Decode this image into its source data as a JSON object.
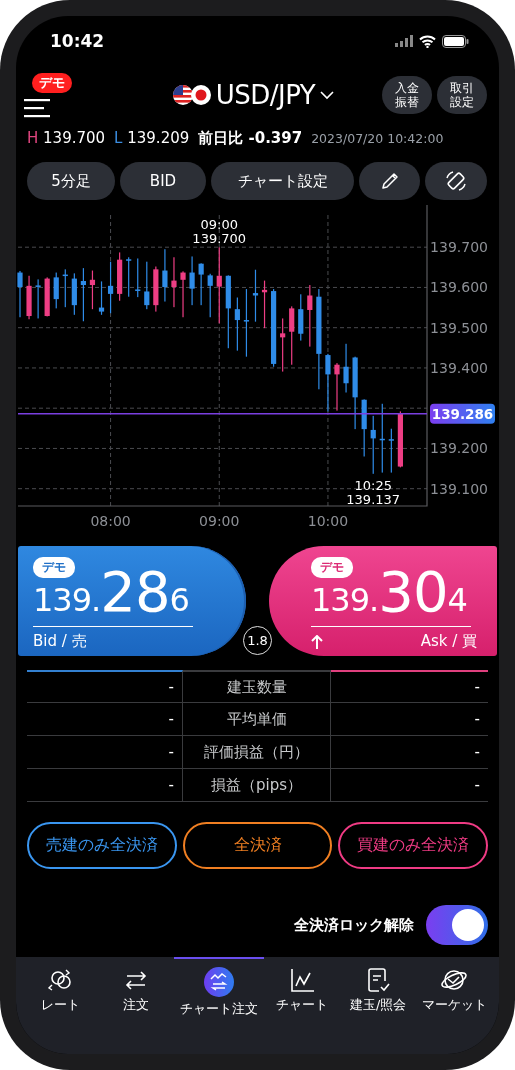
{
  "status_bar": {
    "time": "10:42"
  },
  "header": {
    "demo_badge": "デモ",
    "pair": "USD/JPY",
    "buttons": [
      {
        "label": "入金振替"
      },
      {
        "label": "取引設定"
      }
    ]
  },
  "quote": {
    "high_label": "H",
    "high": "139.700",
    "low_label": "L",
    "low": "139.209",
    "change_label": "前日比",
    "change": "-0.397",
    "timestamp": "2023/07/20 10:42:00"
  },
  "toolbar": [
    {
      "kind": "text",
      "label": "5分足"
    },
    {
      "kind": "text",
      "label": "BID"
    },
    {
      "kind": "text",
      "label": "チャート設定"
    },
    {
      "kind": "pencil"
    },
    {
      "kind": "rotate"
    }
  ],
  "chart": {
    "chart_data": {
      "type": "candlestick",
      "grid": true,
      "ref_lines": [
        {
          "axis": "y",
          "value": 139.286,
          "label": "139.286",
          "color": "#7a3fe0"
        }
      ],
      "categories": [
        null,
        null,
        null,
        null,
        null,
        null,
        null,
        null,
        null,
        null,
        "08:00",
        null,
        null,
        null,
        null,
        null,
        null,
        null,
        null,
        null,
        null,
        null,
        "09:00",
        null,
        null,
        null,
        null,
        null,
        null,
        null,
        null,
        null,
        null,
        null,
        "10:00",
        null,
        null,
        null,
        null,
        null,
        null,
        null,
        null
      ],
      "ohlc": [
        [
          139.637,
          139.641,
          139.526,
          139.601
        ],
        [
          139.529,
          139.629,
          139.521,
          139.604
        ],
        [
          139.605,
          139.62,
          139.523,
          139.603
        ],
        [
          139.529,
          139.625,
          139.528,
          139.622
        ],
        [
          139.625,
          139.637,
          139.548,
          139.571
        ],
        [
          139.632,
          139.645,
          139.551,
          139.629
        ],
        [
          139.622,
          139.635,
          139.532,
          139.556
        ],
        [
          139.616,
          139.648,
          139.516,
          139.606
        ],
        [
          139.606,
          139.642,
          139.546,
          139.619
        ],
        [
          139.55,
          139.615,
          139.532,
          139.54
        ],
        [
          139.604,
          139.664,
          139.536,
          139.584
        ],
        [
          139.584,
          139.687,
          139.567,
          139.669
        ],
        [
          139.67,
          139.675,
          139.577,
          139.669
        ],
        [
          139.595,
          139.672,
          139.576,
          139.594
        ],
        [
          139.59,
          139.664,
          139.546,
          139.556
        ],
        [
          139.556,
          139.652,
          139.54,
          139.645
        ],
        [
          139.642,
          139.695,
          139.565,
          139.601
        ],
        [
          139.601,
          139.675,
          139.551,
          139.617
        ],
        [
          139.619,
          139.64,
          139.526,
          139.637
        ],
        [
          139.637,
          139.677,
          139.556,
          139.597
        ],
        [
          139.659,
          139.66,
          139.556,
          139.632
        ],
        [
          139.63,
          139.634,
          139.526,
          139.604
        ],
        [
          139.602,
          139.7,
          139.511,
          139.629
        ],
        [
          139.629,
          139.63,
          139.449,
          139.548
        ],
        [
          139.546,
          139.575,
          139.443,
          139.519
        ],
        [
          139.519,
          139.596,
          139.428,
          139.518
        ],
        [
          139.586,
          139.644,
          139.515,
          139.58
        ],
        [
          139.588,
          139.617,
          139.499,
          139.594
        ],
        [
          139.591,
          139.596,
          139.403,
          139.41
        ],
        [
          139.476,
          139.523,
          139.391,
          139.486
        ],
        [
          139.49,
          139.553,
          139.408,
          139.548
        ],
        [
          139.546,
          139.583,
          139.468,
          139.485
        ],
        [
          139.544,
          139.606,
          139.453,
          139.58
        ],
        [
          139.577,
          139.596,
          139.347,
          139.435
        ],
        [
          139.432,
          139.435,
          139.292,
          139.384
        ],
        [
          139.384,
          139.412,
          139.294,
          139.408
        ],
        [
          139.403,
          139.46,
          139.339,
          139.362
        ],
        [
          139.426,
          139.428,
          139.248,
          139.327
        ],
        [
          139.321,
          139.322,
          139.18,
          139.248
        ],
        [
          139.246,
          139.281,
          139.137,
          139.225
        ],
        [
          139.224,
          139.311,
          139.14,
          139.223
        ],
        [
          139.223,
          139.249,
          139.14,
          139.221
        ],
        [
          139.155,
          139.292,
          139.153,
          139.286
        ]
      ],
      "ylim": [
        139.057,
        139.78
      ],
      "yticks": [
        {
          "value": 139.7,
          "label": "139.700"
        },
        {
          "value": 139.6,
          "label": "139.600"
        },
        {
          "value": 139.5,
          "label": "139.500"
        },
        {
          "value": 139.4,
          "label": "139.400"
        },
        {
          "value": 139.2,
          "label": "139.200"
        },
        {
          "value": 139.1,
          "label": "139.100"
        }
      ],
      "annotations": [
        {
          "y": 139.7,
          "text": "09:00\n139.700"
        },
        {
          "y": 139.137,
          "text": "10:25\n139.137"
        }
      ]
    }
  },
  "prices": {
    "bid": {
      "badge": "デモ",
      "lead": "139.",
      "big": "28",
      "tail": "6",
      "label": "Bid / 売"
    },
    "spread": "1.8",
    "ask": {
      "badge": "デモ",
      "lead": "139.",
      "big": "30",
      "tail": "4",
      "label": "Ask / 買",
      "rising": true
    }
  },
  "positions": [
    {
      "sell": "-",
      "label": "建玉数量",
      "buy": "-"
    },
    {
      "sell": "-",
      "label": "平均単価",
      "buy": "-"
    },
    {
      "sell": "-",
      "label": "評価損益（円）",
      "buy": "-"
    },
    {
      "sell": "-",
      "label": "損益（pips）",
      "buy": "-"
    }
  ],
  "close_buttons": [
    {
      "kind": "sell",
      "label": "売建のみ全決済"
    },
    {
      "kind": "all",
      "label": "全決済"
    },
    {
      "kind": "buy",
      "label": "買建のみ全決済"
    }
  ],
  "lock_toggle": {
    "label": "全決済ロック解除",
    "on": true
  },
  "tabs": [
    {
      "kind": "rate",
      "label": "レート",
      "selected": false
    },
    {
      "kind": "order",
      "label": "注文",
      "selected": false
    },
    {
      "kind": "chart-order",
      "label": "チャート注文",
      "selected": true
    },
    {
      "kind": "chart",
      "label": "チャート",
      "selected": false
    },
    {
      "kind": "positions",
      "label": "建玉/照会",
      "selected": false
    },
    {
      "kind": "market",
      "label": "マーケット",
      "selected": false
    }
  ]
}
